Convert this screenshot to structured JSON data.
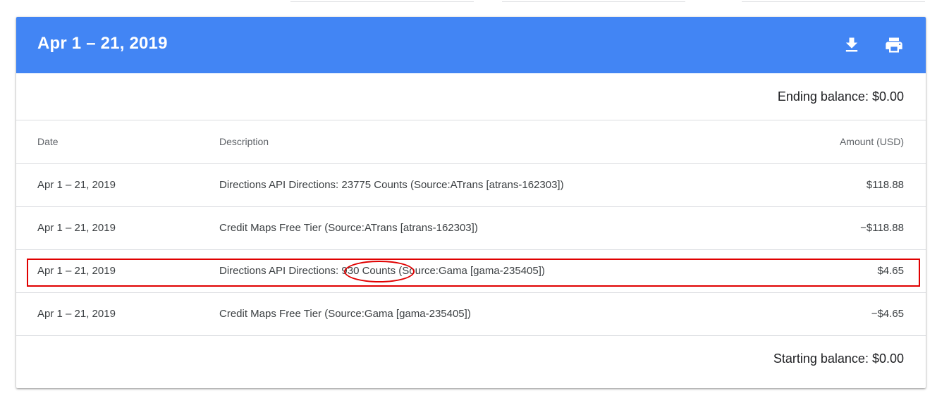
{
  "statement": {
    "period_title": "Apr 1 – 21, 2019",
    "header_color": "#4285f4",
    "actions": {
      "download_icon": "download-icon",
      "print_icon": "print-icon"
    },
    "ending_balance": "Ending balance: $0.00",
    "starting_balance": "Starting balance: $0.00"
  },
  "table": {
    "columns": {
      "date": "Date",
      "description": "Description",
      "amount": "Amount (USD)"
    },
    "rows": [
      {
        "date": "Apr 1 – 21, 2019",
        "description": "Directions API Directions: 23775 Counts (Source:ATrans [atrans-162303])",
        "amount": "$118.88"
      },
      {
        "date": "Apr 1 – 21, 2019",
        "description": "Credit Maps Free Tier (Source:ATrans [atrans-162303])",
        "amount": "−$118.88"
      },
      {
        "date": "Apr 1 – 21, 2019",
        "description": "Directions API Directions: 930 Counts (Source:Gama [gama-235405])",
        "amount": "$4.65"
      },
      {
        "date": "Apr 1 – 21, 2019",
        "description": "Credit Maps Free Tier (Source:Gama [gama-235405])",
        "amount": "−$4.65"
      }
    ]
  },
  "annotations": {
    "highlight_color": "#e00000"
  }
}
